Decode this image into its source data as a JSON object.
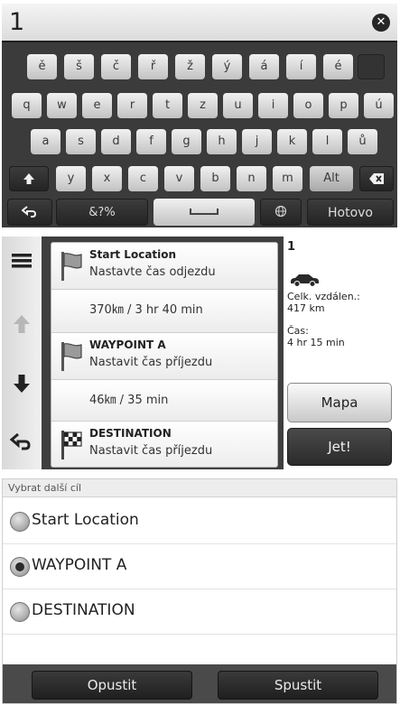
{
  "keyboard_screen": {
    "input_value": "1",
    "row1": [
      "ě",
      "š",
      "č",
      "ř",
      "ž",
      "ý",
      "á",
      "í",
      "é"
    ],
    "row2": [
      "q",
      "w",
      "e",
      "r",
      "t",
      "z",
      "u",
      "i",
      "o",
      "p",
      "ú"
    ],
    "row3": [
      "a",
      "s",
      "d",
      "f",
      "g",
      "h",
      "j",
      "k",
      "l",
      "ů"
    ],
    "row4": [
      "y",
      "x",
      "c",
      "v",
      "b",
      "n",
      "m"
    ],
    "alt_label": "Alt",
    "symbols_label": "&?%",
    "done_label": "Hotovo"
  },
  "route_screen": {
    "stops": [
      {
        "title": "Start Location",
        "action": "Nastavte čas odjezdu",
        "icon": "flag-icon"
      },
      {
        "title": "WAYPOINT A",
        "action": "Nastavit čas příjezdu",
        "icon": "flag-icon"
      },
      {
        "title": "DESTINATION",
        "action": "Nastavit čas příjezdu",
        "icon": "checkered-flag-icon"
      }
    ],
    "legs": [
      "370㎞ / 3 hr 40 min",
      "46㎞ / 35 min"
    ],
    "summary": {
      "number": "1",
      "distance_label": "Celk. vzdálen.:",
      "distance_value": "417 km",
      "time_label": "Čas:",
      "time_value": "4 hr 15 min"
    },
    "map_button": "Mapa",
    "go_button": "Jet!"
  },
  "select_screen": {
    "header": "Vybrat další cíl",
    "options": [
      "Start Location",
      "WAYPOINT A",
      "DESTINATION"
    ],
    "selected_index": 1,
    "cancel_button": "Opustit",
    "start_button": "Spustit"
  },
  "colors": {
    "keyboard_bg": "#3b3b3b",
    "key_face": "#dcdcdc",
    "dark_button": "#2b2b2b",
    "route_bg": "#3f3f3f"
  }
}
